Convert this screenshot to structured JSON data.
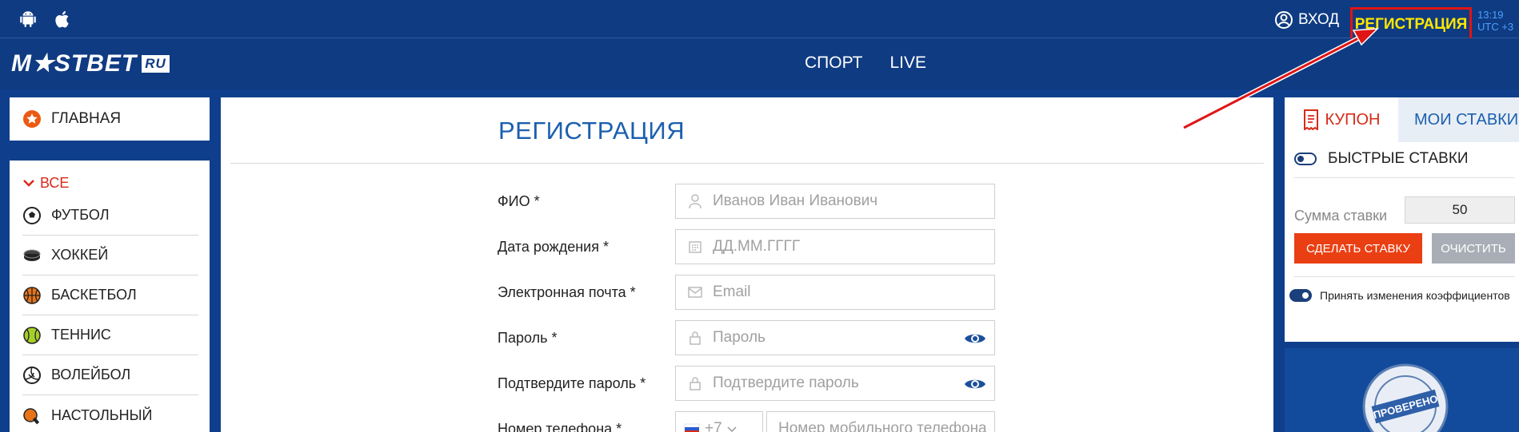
{
  "header": {
    "os_icons": [
      "android-icon",
      "apple-icon"
    ],
    "login_label": "ВХОД",
    "register_label": "РЕГИСТРАЦИЯ",
    "time": "13:19",
    "timezone": "UTC +3"
  },
  "nav": {
    "logo_text": "M★STBET",
    "logo_suffix": "RU",
    "links": [
      "СПОРТ",
      "LIVE"
    ]
  },
  "sidebar": {
    "home_label": "ГЛАВНАЯ",
    "all_label": "ВСЕ",
    "sports": [
      {
        "label": "ФУТБОЛ",
        "icon": "soccer-ball-icon"
      },
      {
        "label": "ХОККЕЙ",
        "icon": "hockey-puck-icon"
      },
      {
        "label": "БАСКЕТБОЛ",
        "icon": "basketball-icon"
      },
      {
        "label": "ТЕННИС",
        "icon": "tennis-ball-icon"
      },
      {
        "label": "ВОЛЕЙБОЛ",
        "icon": "volleyball-icon"
      },
      {
        "label": "НАСТОЛЬНЫЙ",
        "icon": "table-tennis-icon"
      }
    ]
  },
  "main": {
    "title": "РЕГИСТРАЦИЯ",
    "fields": [
      {
        "label": "ФИО *",
        "placeholder": "Иванов Иван Иванович",
        "icon": "user-icon"
      },
      {
        "label": "Дата рождения *",
        "placeholder": "ДД.ММ.ГГГГ",
        "icon": "calendar-icon"
      },
      {
        "label": "Электронная почта *",
        "placeholder": "Email",
        "icon": "envelope-icon"
      },
      {
        "label": "Пароль *",
        "placeholder": "Пароль",
        "icon": "lock-icon"
      },
      {
        "label": "Подтвердите пароль *",
        "placeholder": "Подтвердите пароль",
        "icon": "lock-icon"
      },
      {
        "label": "Номер телефона *",
        "placeholder": "Номер мобильного телефона",
        "icon": "flag-icon"
      }
    ],
    "phone_code": "+7"
  },
  "coupon": {
    "tab_coupon": "КУПОН",
    "tab_my_bets": "МОИ СТАВКИ",
    "quick_bets_label": "БЫСТРЫЕ СТАВКИ",
    "sum_label": "Сумма ставки",
    "sum_value": "50",
    "bet_button": "СДЕЛАТЬ СТАВКУ",
    "clear_button": "ОЧИСТИТЬ",
    "accept_changes_label": "Принять изменения коэффициентов"
  },
  "banner": {
    "seal_text": "ПРОВЕРЕНО"
  },
  "colors": {
    "brand_blue": "#0f3b82",
    "accent_red": "#ea3f13",
    "highlight_yellow": "#ffe600",
    "annotation_red": "#e01414"
  }
}
